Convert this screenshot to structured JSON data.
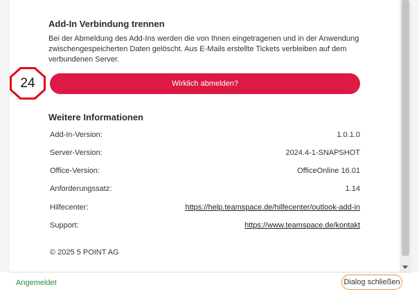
{
  "disconnect": {
    "title": "Add-In Verbindung trennen",
    "description": "Bei der Abmeldung des Add-Ins werden die von Ihnen eingetragenen und in der Anwendung zwischengespeicherten Daten gelöscht. Aus E-Mails erstellte Tickets verbleiben auf dem verbundenen Server.",
    "logout_label": "Wirklich abmelden?",
    "badge_number": "24"
  },
  "info": {
    "title": "Weitere Informationen",
    "rows": [
      {
        "label": "Add-In-Version:",
        "value": "1.0.1.0"
      },
      {
        "label": "Server-Version:",
        "value": "2024.4-1-SNAPSHOT"
      },
      {
        "label": "Office-Version:",
        "value": "OfficeOnline 16.01"
      },
      {
        "label": "Anforderungssatz:",
        "value": "1.14"
      },
      {
        "label": "Hilfecenter:",
        "value": "https://help.teamspace.de/hilfecenter/outlook-add-in"
      },
      {
        "label": "Support:",
        "value": "https://www.teamspace.de/kontakt"
      }
    ],
    "copyright": "© 2025 5 POINT AG"
  },
  "footer": {
    "status": "Angemeldet",
    "close_label": "Dialog schließen"
  },
  "colors": {
    "primary": "#dc1a43",
    "badge": "#e30613",
    "status": "#2e8b3d",
    "close_border": "#e8953a"
  }
}
